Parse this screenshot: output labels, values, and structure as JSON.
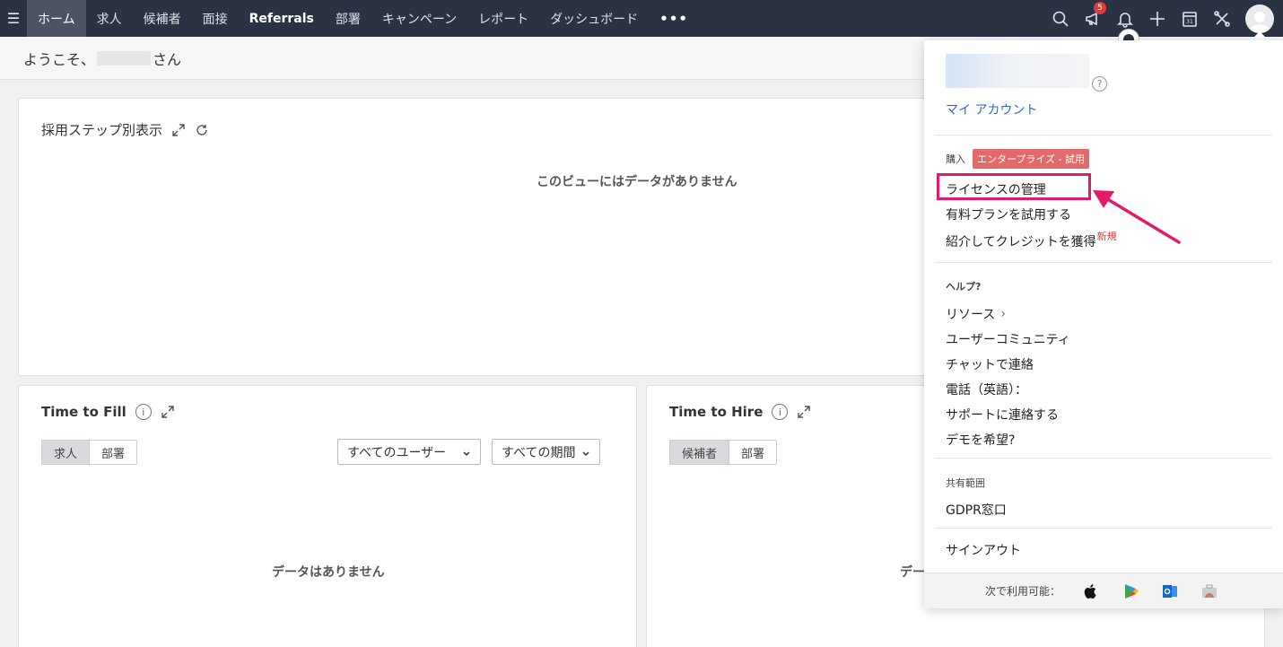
{
  "nav": {
    "tabs": [
      "ホーム",
      "求人",
      "候補者",
      "面接",
      "Referrals",
      "部署",
      "キャンペーン",
      "レポート",
      "ダッシュボード"
    ],
    "more": "•••",
    "notification_count": "5",
    "calendar_day": "31"
  },
  "welcome": {
    "prefix": "ようこそ、",
    "suffix": "さん"
  },
  "cards": {
    "pipeline": {
      "title": "採用ステップ別表示",
      "empty": "このビューにはデータがありません"
    },
    "time_to_fill": {
      "title": "Time to Fill",
      "seg": [
        "求人",
        "部署"
      ],
      "users_dropdown": "すべてのユーザー",
      "period_dropdown": "すべての期間",
      "empty": "データはありません"
    },
    "time_to_hire": {
      "title": "Time to Hire",
      "seg": [
        "候補者",
        "部署"
      ],
      "empty_partial": "デー"
    }
  },
  "panel": {
    "my_account": "マイ アカウント",
    "purchase_label": "購入",
    "trial_badge": "エンタープライズ - 試用",
    "manage_license": "ライセンスの管理",
    "try_paid_plan": "有料プランを試用する",
    "refer_credit": "紹介してクレジットを獲得",
    "new_tag": "新規",
    "help_label": "ヘルプ?",
    "resources": "リソース",
    "user_community": "ユーザーコミュニティ",
    "chat_contact": "チャットで連絡",
    "phone": "電話（英語）：",
    "contact_support": "サポートに連絡する",
    "request_demo": "デモを希望?",
    "scope_label": "共有範囲",
    "gdpr": "GDPR窓口",
    "sign_out": "サインアウト",
    "available_on": "次で利用可能："
  },
  "colors": {
    "nav_bg": "#2b3244",
    "highlight": "#e3196b",
    "link": "#2d6bcb",
    "trial_badge": "#e26a6a"
  },
  "icons": [
    "search-icon",
    "megaphone-icon",
    "bell-icon",
    "plus-icon",
    "calendar-icon",
    "tools-icon",
    "avatar-icon",
    "expand-icon",
    "refresh-icon",
    "info-icon",
    "apple-icon",
    "google-play-icon",
    "outlook-icon",
    "briefcase-icon"
  ]
}
